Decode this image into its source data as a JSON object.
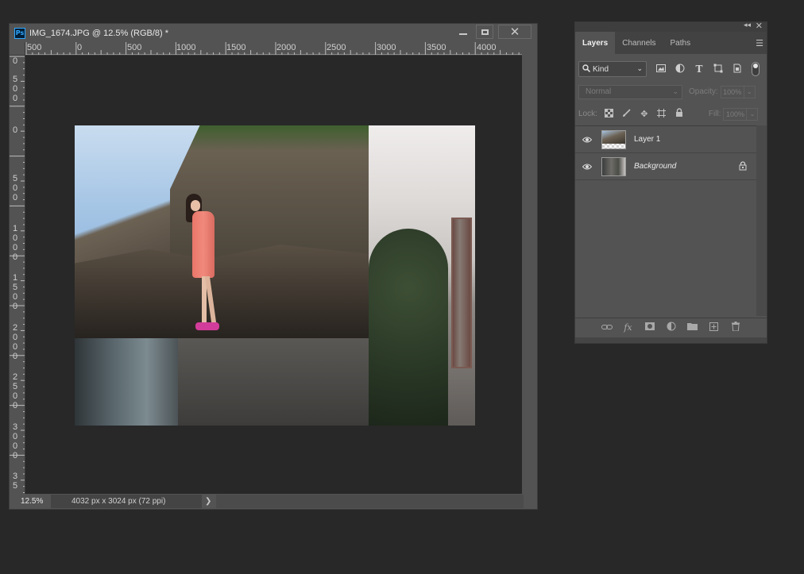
{
  "document": {
    "title": "IMG_1674.JPG @ 12.5% (RGB/8) *",
    "app_icon": "Ps",
    "window_controls": {
      "minimize": "minimize-icon",
      "maximize": "maximize-icon",
      "close": "close-icon"
    },
    "ruler_h": [
      "500",
      "0",
      "500",
      "1000",
      "1500",
      "2000",
      "2500",
      "3000",
      "3500",
      "4000"
    ],
    "ruler_v": [
      "0",
      "5\n0\n0",
      "0",
      "5\n0\n0",
      "1\n0\n0\n0",
      "1\n5\n0\n0",
      "2\n0\n0\n0",
      "2\n5\n0\n0",
      "3\n0\n0\n0",
      "3\n5"
    ],
    "status": {
      "zoom": "12.5%",
      "info": "4032 px x 3024 px (72 ppi)",
      "arrow": "❯"
    }
  },
  "layers_panel": {
    "tabs": [
      {
        "label": "Layers",
        "active": true
      },
      {
        "label": "Channels",
        "active": false
      },
      {
        "label": "Paths",
        "active": false
      }
    ],
    "filter": {
      "kind_label": "Kind"
    },
    "blend_mode": "Normal",
    "opacity_label": "Opacity:",
    "opacity_value": "100%",
    "lock_label": "Lock:",
    "fill_label": "Fill:",
    "fill_value": "100%",
    "layers": [
      {
        "name": "Layer 1",
        "visible": true,
        "locked": false,
        "italic": false
      },
      {
        "name": "Background",
        "visible": true,
        "locked": true,
        "italic": true
      }
    ]
  },
  "colors": {
    "workspace": "#282828",
    "panel": "#535353",
    "accent_ps": "#31a8ff"
  }
}
